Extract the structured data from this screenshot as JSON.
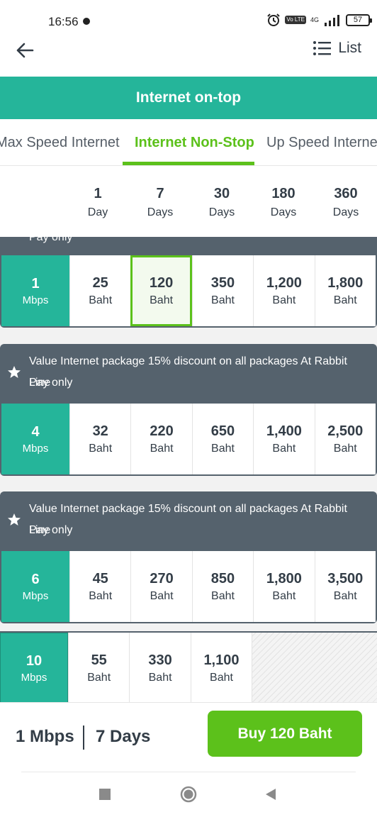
{
  "status_bar": {
    "time": "16:56",
    "volte": "Vo LTE",
    "network": "4G",
    "battery": "57",
    "icons": [
      "notification-dot-icon",
      "alarm-icon",
      "volte-icon",
      "signal-icon",
      "battery-icon"
    ]
  },
  "header": {
    "back_icon": "arrow-left-icon",
    "list_label": "List",
    "list_icon": "list-icon"
  },
  "banner": {
    "title": "Internet on-top"
  },
  "tabs": [
    {
      "label": "Max Speed Internet",
      "active": false
    },
    {
      "label": "Internet Non-Stop",
      "active": true
    },
    {
      "label": "Up Speed Internet",
      "active": false
    }
  ],
  "day_columns": [
    {
      "num": "1",
      "unit": "Day"
    },
    {
      "num": "7",
      "unit": "Days"
    },
    {
      "num": "30",
      "unit": "Days"
    },
    {
      "num": "180",
      "unit": "Days"
    },
    {
      "num": "360",
      "unit": "Days"
    }
  ],
  "partial_header_text": "Pay only",
  "packages": [
    {
      "speed": "1",
      "speed_unit": "Mbps",
      "prices": [
        {
          "num": "25",
          "unit": "Baht"
        },
        {
          "num": "120",
          "unit": "Baht",
          "selected": true
        },
        {
          "num": "350",
          "unit": "Baht"
        },
        {
          "num": "1,200",
          "unit": "Baht"
        },
        {
          "num": "1,800",
          "unit": "Baht"
        }
      ]
    },
    {
      "description_line1": "Value Internet package 15% discount on all packages At Rabbit Line",
      "description_line2": "Pay only",
      "icon": "star-icon",
      "speed": "4",
      "speed_unit": "Mbps",
      "prices": [
        {
          "num": "32",
          "unit": "Baht"
        },
        {
          "num": "220",
          "unit": "Baht"
        },
        {
          "num": "650",
          "unit": "Baht"
        },
        {
          "num": "1,400",
          "unit": "Baht"
        },
        {
          "num": "2,500",
          "unit": "Baht"
        }
      ]
    },
    {
      "description_line1": "Value Internet package 15% discount on all packages At Rabbit Line",
      "description_line2": "Pay only",
      "icon": "star-icon",
      "speed": "6",
      "speed_unit": "Mbps",
      "prices": [
        {
          "num": "45",
          "unit": "Baht"
        },
        {
          "num": "270",
          "unit": "Baht"
        },
        {
          "num": "850",
          "unit": "Baht"
        },
        {
          "num": "1,800",
          "unit": "Baht"
        },
        {
          "num": "3,500",
          "unit": "Baht"
        }
      ]
    },
    {
      "speed": "10",
      "speed_unit": "Mbps",
      "prices": [
        {
          "num": "55",
          "unit": "Baht"
        },
        {
          "num": "330",
          "unit": "Baht"
        },
        {
          "num": "1,100",
          "unit": "Baht"
        }
      ]
    }
  ],
  "selection": {
    "speed": "1 Mbps",
    "days": "7 Days",
    "buy_label": "Buy 120 Baht"
  },
  "nav": {
    "icons": [
      "recent-apps-icon",
      "home-icon",
      "back-triangle-icon"
    ]
  },
  "colors": {
    "primary": "#25b59a",
    "accent": "#5cc11b",
    "slate": "#55626d",
    "text": "#333d47"
  }
}
